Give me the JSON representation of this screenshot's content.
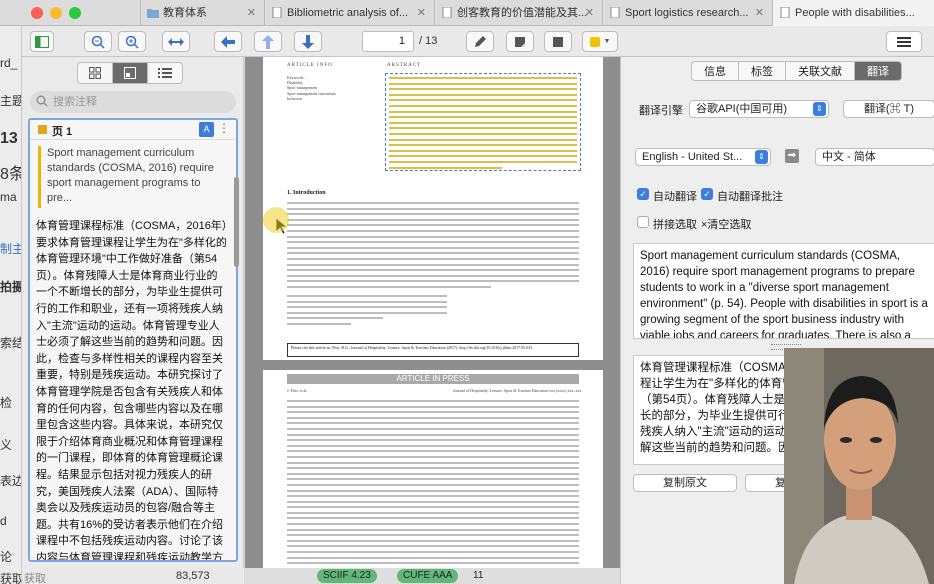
{
  "tabs": [
    {
      "label": "教育体系",
      "icon": "folder-icon"
    },
    {
      "label": "Bibliometric analysis of..."
    },
    {
      "label": "创客教育的价值潜能及其..."
    },
    {
      "label": "Sport logistics research..."
    },
    {
      "label": "People with disabilities..."
    }
  ],
  "toolbar": {
    "page_current": "1",
    "page_total": "/ 13"
  },
  "left_strip": {
    "fragments": [
      "rd_",
      "主题",
      "13",
      "8条",
      "ma",
      "制主",
      "拍摄",
      "索结",
      "检",
      "义",
      "表边",
      "d",
      "论",
      "获取"
    ]
  },
  "annotations": {
    "search_placeholder": "搜索注释",
    "page_label": "页 1",
    "translate_badge": "A",
    "quote": "Sport management curriculum standards (COSMA, 2016) require sport management programs to pre...",
    "comment": "体育管理课程标准（COSMA，2016年）要求体育管理课程让学生为在\"多样化的体育管理环境\"中工作做好准备（第54页）。体育残障人士是体育商业行业的一个不断增长的部分，为毕业生提供可行的工作和职业，还有一项将残疾人纳入\"主流\"运动的运动。体育管理专业人士必须了解这些当前的趋势和问题。因此，检查与多样性相关的课程内容至关重要，特别是残疾运动。本研究探讨了体育管理学院是否包含有关残疾人和体育的任何内容，包含哪些内容以及在哪里包含这些内容。具体来说，本研究仅限于介绍体育商业概况和体育管理课程的一门课程，即体育的体育管理概论课程。结果显示包括对视力残疾人的研究，美国残疾人法案（ADA）、国际特奥会以及残疾运动员的包容/融合等主题。共有16%的受访者表示他们在介绍课程中不包括残疾运动内容。讨论了该内容与体育管理课程和残疾运动教学方法以及对课程开发的影响的联系"
  },
  "bottom_left": {
    "label": "获取",
    "value": "83,573"
  },
  "pdf": {
    "article_info": "ARTICLE INFO",
    "abstract": "ABSTRACT",
    "keywords": [
      "Keywords:",
      "Disability",
      "Sport management",
      "Sport management curriculum",
      "Inclusion"
    ],
    "intro_heading": "1. Introduction",
    "notice": "Please cite this article as: Pitts, B.G., Journal of Hospitality, Leisure, Sport & Tourism Education (2017), http://dx.doi.org/10.1016/j.jhlste.2017.05.033",
    "article_in_press": "ARTICLE IN PRESS",
    "page2_header_left": "J. Pitts, et al.",
    "page2_header_right": "Journal of Hospitality, Leisure, Sport & Tourism Education xxx (xxxx) xxx–xxx"
  },
  "right_panel": {
    "tabs": [
      "信息",
      "标签",
      "关联文献",
      "翻译"
    ],
    "active_tab": "翻译",
    "engine_label": "翻译引擎",
    "engine_value": "谷歌API(中国可用)",
    "translate_button": "翻译(⌘ T)",
    "source_lang": "English - United St...",
    "target_lang": "中文 - 简体",
    "auto_translate": "自动翻译",
    "auto_translate_annotations": "自动翻译批注",
    "concat_select": "拼接选取",
    "clear_select": "×清空选取",
    "source_text": "Sport management curriculum standards (COSMA, 2016) require sport management programs to prepare students to work in a \"diverse sport management environment\" (p. 54). People with disabilities in sport is a growing segment of the sport business industry with viable jobs and careers for graduates. There is also a",
    "translated_text": "体育管理课程标准（COSMA，2016年）要求体育管理课程让学生为在\"多样化的体育管理环境\"中工作做好准备（第54页）。体育残障人士是体育商业行业的一个不断增长的部分，为毕业生提供可行的工作和职业，还有一项将残疾人纳入\"主流\"运动的运动。体育管理专业人士必须了解这些当前的趋势和问题。因此，检查与多样性相关的",
    "copy_source": "复制原文",
    "copy_translation": "复制翻译"
  },
  "status": {
    "badges": [
      {
        "label": "SCIIF 4.23",
        "color": "#5fb87a"
      },
      {
        "label": "CUFE AAA",
        "color": "#5fb87a"
      }
    ],
    "count": "11"
  },
  "colors": {
    "accent": "#3a7fe0",
    "highlight": "#f0b400",
    "active_tab": "#6b6b6b"
  }
}
